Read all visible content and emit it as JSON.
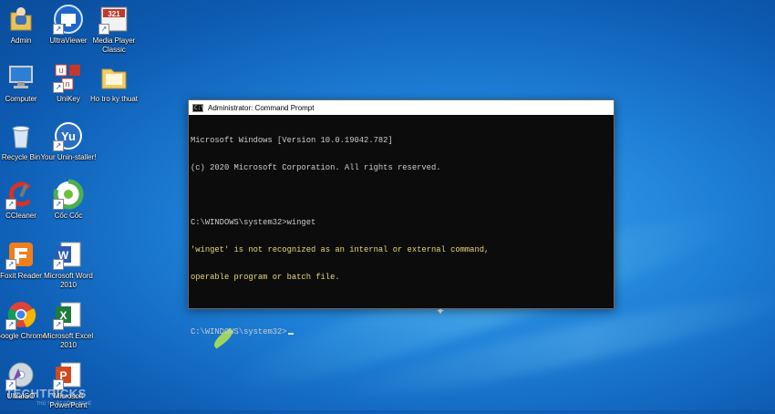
{
  "desktop": {
    "icons": [
      {
        "label": "Admin",
        "icon": "user-folder-icon"
      },
      {
        "label": "UltraViewer",
        "icon": "ultraviewer-icon"
      },
      {
        "label": "Media Player Classic",
        "icon": "media-player-classic-icon"
      },
      {
        "label": "Computer",
        "icon": "computer-icon"
      },
      {
        "label": "UniKey",
        "icon": "unikey-icon"
      },
      {
        "label": "Ho tro ky thuat",
        "icon": "folder-icon"
      },
      {
        "label": "Recycle Bin",
        "icon": "recycle-bin-icon"
      },
      {
        "label": "Your Unin-staller!",
        "icon": "uninstaller-icon"
      },
      {
        "label": "CCleaner",
        "icon": "ccleaner-icon"
      },
      {
        "label": "Cốc Cốc",
        "icon": "coccoc-browser-icon"
      },
      {
        "label": "Foxit Reader",
        "icon": "foxit-reader-icon"
      },
      {
        "label": "Microsoft Word 2010",
        "icon": "word-icon"
      },
      {
        "label": "Google Chrome",
        "icon": "chrome-icon"
      },
      {
        "label": "Microsoft Excel 2010",
        "icon": "excel-icon"
      },
      {
        "label": "UltraISO",
        "icon": "ultraiso-icon"
      },
      {
        "label": "Microsoft PowerPoint",
        "icon": "powerpoint-icon"
      }
    ]
  },
  "cmd_window": {
    "title": "Administrator: Command Prompt",
    "lines": [
      "Microsoft Windows [Version 10.0.19042.782]",
      "(c) 2020 Microsoft Corporation. All rights reserved.",
      "",
      "C:\\WINDOWS\\system32>winget",
      "'winget' is not recognized as an internal or external command,",
      "operable program or batch file.",
      "",
      "C:\\WINDOWS\\system32>"
    ],
    "error_color": "#e9d675",
    "text_color": "#cccccc"
  },
  "watermark": {
    "text": "TECHTRICKS",
    "sub": "THỦ THUẬT CÔNG NGHỆ"
  },
  "colors": {
    "desktop_bg": "#1e7fd6",
    "console_bg": "#0c0c0c"
  }
}
